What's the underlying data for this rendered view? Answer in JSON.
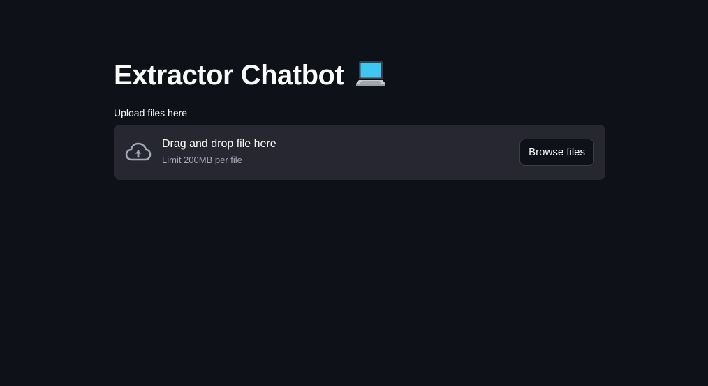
{
  "page": {
    "title": "Extractor Chatbot",
    "title_icon": "laptop-emoji"
  },
  "uploader": {
    "label": "Upload files here",
    "dropzone_text": "Drag and drop file here",
    "limit_text": "Limit 200MB per file",
    "browse_label": "Browse files",
    "icon": "cloud-upload-icon"
  },
  "colors": {
    "background": "#0e1117",
    "dropzone_bg": "#262730",
    "text": "#fafafa",
    "muted_text": "#a3a8b8"
  }
}
